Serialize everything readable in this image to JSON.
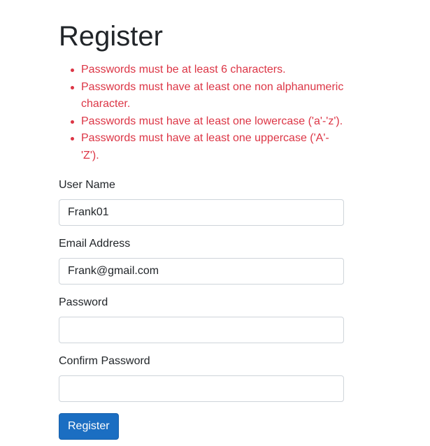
{
  "page": {
    "title": "Register"
  },
  "validation_errors": [
    "Passwords must be at least 6 characters.",
    "Passwords must have at least one non alphanumeric character.",
    "Passwords must have at least one lowercase ('a'-'z').",
    "Passwords must have at least one uppercase ('A'-'Z')."
  ],
  "form": {
    "user_name": {
      "label": "User Name",
      "value": "Frank01"
    },
    "email": {
      "label": "Email Address",
      "value": "Frank@gmail.com"
    },
    "password": {
      "label": "Password",
      "value": ""
    },
    "confirm_password": {
      "label": "Confirm Password",
      "value": ""
    },
    "submit_label": "Register"
  },
  "colors": {
    "error": "#dc3545",
    "primary_button": "#1b6ec2",
    "input_border": "#ced4da"
  }
}
